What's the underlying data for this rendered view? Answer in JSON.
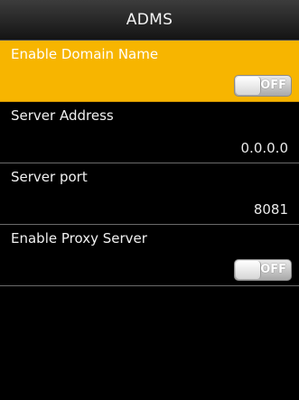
{
  "header": {
    "title": "ADMS"
  },
  "items": [
    {
      "label": "Enable Domain Name",
      "toggle": "OFF",
      "selected": true
    },
    {
      "label": "Server Address",
      "value": "0.0.0.0"
    },
    {
      "label": "Server port",
      "value": "8081"
    },
    {
      "label": "Enable Proxy Server",
      "toggle": "OFF"
    }
  ],
  "colors": {
    "highlight": "#f7b500",
    "background": "#000000",
    "divider": "#6a6a6a"
  }
}
